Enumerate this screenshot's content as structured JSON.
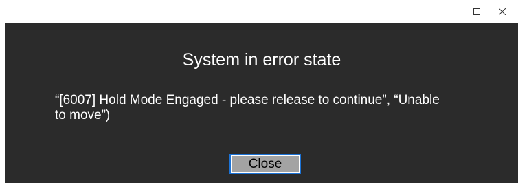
{
  "dialog": {
    "title": "System in error state",
    "message": "“[6007] Hold Mode Engaged - please release to continue”, “Unable to move”)",
    "close_label": "Close"
  },
  "window_controls": {
    "minimize_icon": "minimize-icon",
    "maximize_icon": "maximize-icon",
    "close_icon": "close-icon"
  },
  "colors": {
    "background": "#2b2b2b",
    "text": "#ffffff",
    "button_face": "#a3a3a3",
    "button_focus_border": "#1c73d6"
  }
}
